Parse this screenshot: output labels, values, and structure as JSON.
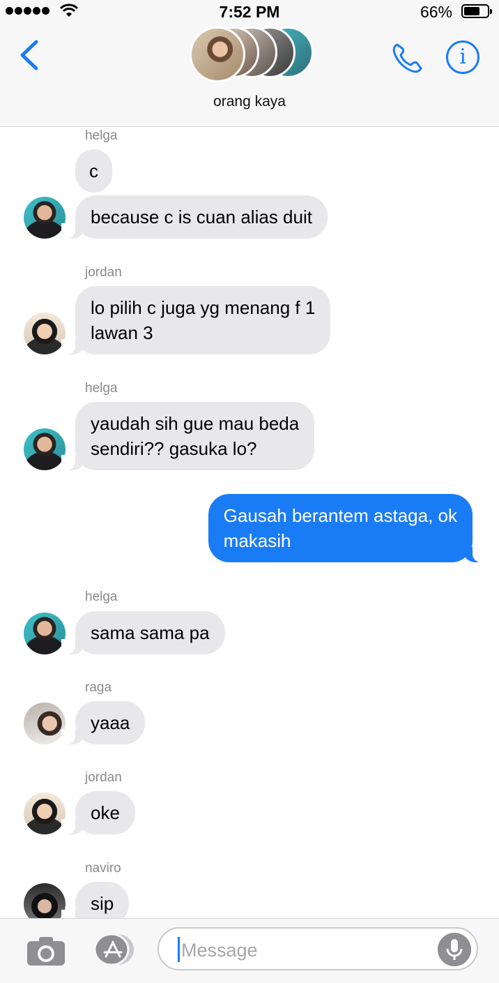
{
  "status_bar": {
    "time": "7:52 PM",
    "battery_percent": "66%",
    "battery_level": 0.66,
    "signal_bars": 5
  },
  "header": {
    "group_name": "orang kaya",
    "back_icon": "chevron-left-icon",
    "call_icon": "phone-icon",
    "info_icon": "info-icon",
    "info_glyph": "i"
  },
  "messages": [
    {
      "sender": "helga",
      "text_lines": [
        "c"
      ],
      "direction": "incoming",
      "avatar": "helga"
    },
    {
      "sender": "",
      "text_lines": [
        "because c is cuan alias duit"
      ],
      "direction": "incoming",
      "avatar": "helga"
    },
    {
      "sender": "jordan",
      "text_lines": [
        "lo pilih c juga yg menang f 1",
        "lawan 3"
      ],
      "direction": "incoming",
      "avatar": "jordan"
    },
    {
      "sender": "helga",
      "text_lines": [
        "yaudah sih gue mau beda",
        "sendiri?? gasuka lo?"
      ],
      "direction": "incoming",
      "avatar": "helga"
    },
    {
      "sender": "",
      "text_lines": [
        "Gausah berantem astaga, ok",
        "makasih"
      ],
      "direction": "outgoing"
    },
    {
      "sender": "helga",
      "text_lines": [
        "sama sama pa"
      ],
      "direction": "incoming",
      "avatar": "helga"
    },
    {
      "sender": "raga",
      "text_lines": [
        "yaaa"
      ],
      "direction": "incoming",
      "avatar": "raga"
    },
    {
      "sender": "jordan",
      "text_lines": [
        "oke"
      ],
      "direction": "incoming",
      "avatar": "jordan"
    },
    {
      "sender": "naviro",
      "text_lines": [
        "sip"
      ],
      "direction": "incoming",
      "avatar": "naviro"
    }
  ],
  "compose": {
    "placeholder": "Message",
    "camera_icon": "camera-icon",
    "apps_icon": "app-store-icon",
    "mic_icon": "microphone-icon"
  },
  "colors": {
    "accent": "#1a7cf5",
    "incoming_bubble": "#e8e8eb",
    "outgoing_bubble": "#1a7cf5",
    "header_bg": "#f7f7f8"
  }
}
